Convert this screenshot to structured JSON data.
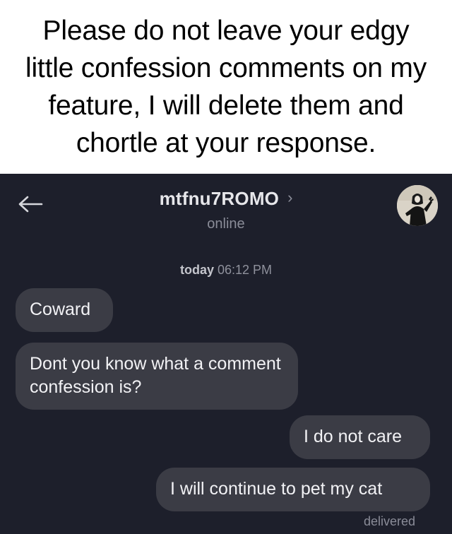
{
  "caption": {
    "text": "Please do not leave your edgy little confession comments on my feature, I will delete them and chortle at your response."
  },
  "header": {
    "back_icon": "arrow-left-icon",
    "name": "mtfnu7ROMO",
    "chevron": "›",
    "status": "online"
  },
  "timestamp": {
    "day": "today",
    "time": "06:12 PM"
  },
  "messages": [
    {
      "direction": "incoming",
      "text": "Coward"
    },
    {
      "direction": "incoming",
      "text": "Dont you know what a comment confession is?"
    },
    {
      "direction": "outgoing",
      "text": "I do not care"
    },
    {
      "direction": "outgoing",
      "text": "I will continue to pet my cat"
    }
  ],
  "delivery_status": "delivered",
  "colors": {
    "background": "#1d1f2b",
    "bubble": "#3b3c45",
    "text_primary": "#e6e6ea",
    "text_muted": "#8a8c98"
  }
}
